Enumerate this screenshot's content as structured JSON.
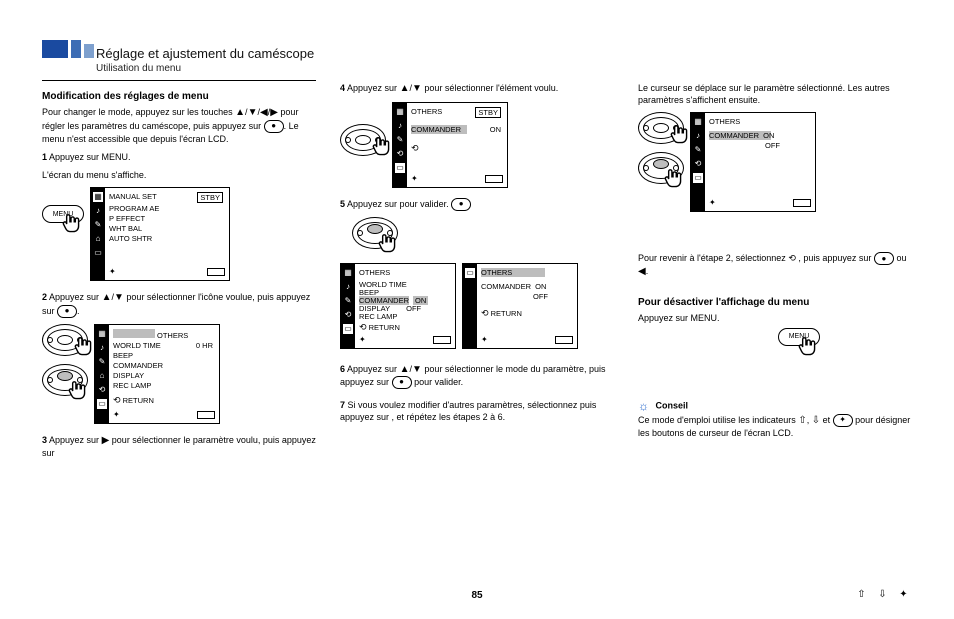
{
  "header": {
    "title": "Réglage et ajustement du caméscope",
    "subtitle": "Utilisation du menu"
  },
  "col1": {
    "section_title": "Modification des réglages de menu",
    "intro_a": "Pour changer le mode, appuyez sur les touches",
    "intro_b": "pour régler les paramètres du caméscope, puis appuyez sur",
    "intro_c": ". Le menu n'est accessible que depuis l'écran LCD.",
    "step1_label": "1",
    "step1": "Appuyez sur MENU.",
    "step1_after": "L'écran du menu s'affiche.",
    "step2_label": "2",
    "step2_a": "Appuyez sur",
    "step2_b": "pour sélectionner l'icône voulue, puis appuyez sur",
    "step3_label": "3",
    "step3_a": "Appuyez sur",
    "step3_b": "pour sélectionner le paramètre voulu, puis appuyez sur",
    "screen1": {
      "items": [
        "MANUAL SET",
        "PROGRAM AE",
        "P EFFECT",
        "WHT BAL",
        "AUTO SHTR"
      ],
      "mode": "STBY"
    },
    "screen2": {
      "title": "OTHERS",
      "items": [
        "WORLD TIME",
        "BEEP",
        "COMMANDER",
        "DISPLAY",
        "REC LAMP"
      ],
      "ret": "RETURN",
      "val": "0 HR"
    }
  },
  "col2": {
    "step4_label": "4",
    "step4_a": "Appuyez sur",
    "step4_b": "pour sélectionner l'élément voulu.",
    "screen3": {
      "header": "OTHERS",
      "label": "COMMANDER",
      "val": "ON",
      "mode": "STBY"
    },
    "step5_label": "5",
    "step5": "Appuyez sur      pour valider.",
    "step6_label": "6",
    "step6_a": "Appuyez sur",
    "step6_b": "pour sélectionner le mode du paramètre, puis appuyez sur",
    "step6_c": "pour valider.",
    "screens45": {
      "header": "OTHERS",
      "items": [
        "WORLD TIME",
        "BEEP",
        "COMMANDER",
        "DISPLAY",
        "REC LAMP"
      ],
      "ret": "RETURN",
      "on": "ON",
      "off": "OFF"
    },
    "step7_label": "7",
    "step7": "Si vous voulez modifier d'autres paramètres, sélectionnez      puis appuyez sur      , et répétez les étapes 2 à 6."
  },
  "col3": {
    "result_a": "Le curseur se déplace sur le paramètre sélectionné. Les autres paramètres s'affichent ensuite.",
    "screen6": {
      "header": "OTHERS",
      "label": "COMMANDER",
      "on": "ON",
      "off": "OFF"
    },
    "return_a": "Pour revenir à l'étape 2, sélectionnez",
    "return_b": ", puis appuyez sur",
    "quit_title": "Pour désactiver l'affichage du menu",
    "quit_body": "Appuyez sur MENU.",
    "tip_title": "Conseil",
    "tip_body_a": "Ce mode d'emploi utilise les indicateurs",
    "tip_body_b": "et",
    "tip_body_c": "pour désigner les boutons de curseur de l'écran LCD."
  },
  "page_number": "85",
  "ret_sym": "⤴",
  "exec_sym": "●"
}
